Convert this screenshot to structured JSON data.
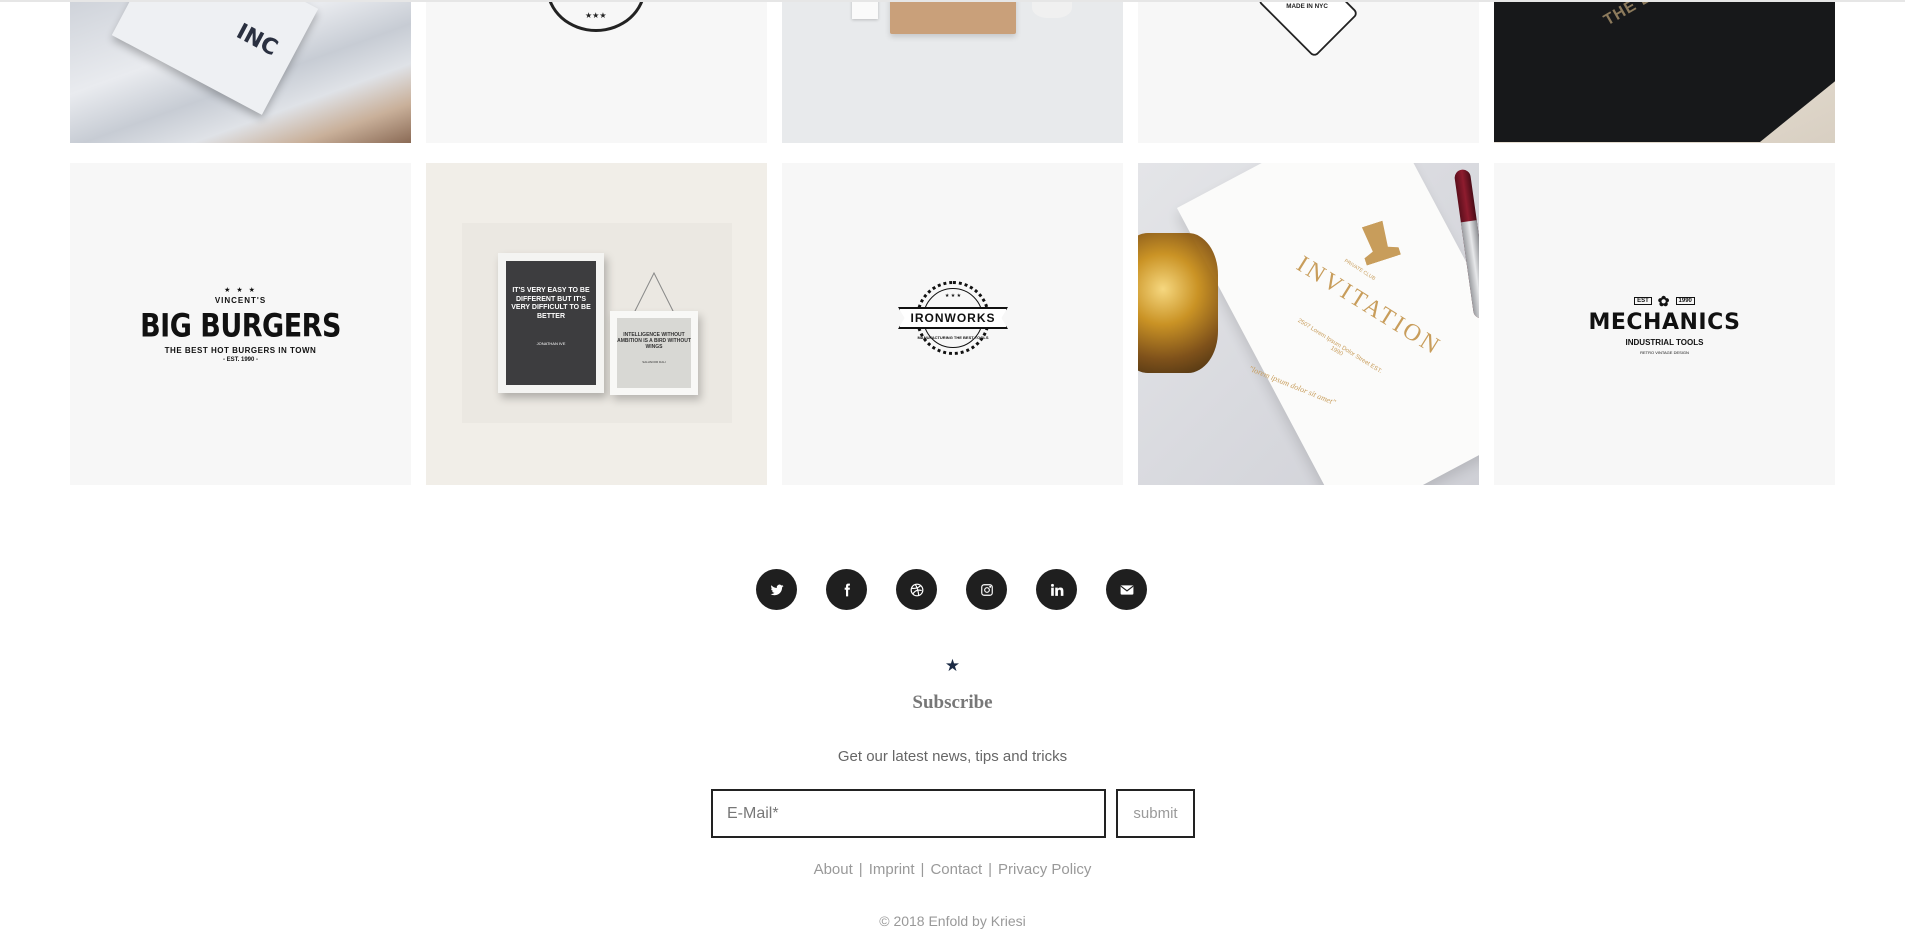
{
  "portfolio": {
    "row1": [
      {
        "name": "business-card-inc",
        "visible_text": "INC"
      },
      {
        "name": "round-badge-logo",
        "visible_text": "★★★"
      },
      {
        "name": "kraft-box-packaging",
        "visible_text": ""
      },
      {
        "name": "made-in-nyc-badge",
        "visible_text": "MADE IN NYC"
      },
      {
        "name": "black-tshirt",
        "visible_text": "THE B"
      }
    ],
    "big_burgers": {
      "stars": "★ ★ ★",
      "brand": "VINCENT'S",
      "title": "BIG BURGERS",
      "tagline": "THE BEST HOT BURGERS IN TOWN",
      "est": "- EST. 1990 -"
    },
    "quote_frames": {
      "dark_quote": "IT'S VERY EASY TO BE DIFFERENT BUT IT'S VERY DIFFICULT TO BE BETTER",
      "dark_author": "JONATHAN IVE",
      "light_quote": "INTELLIGENCE WITHOUT AMBITION IS A BIRD WITHOUT WINGS",
      "light_author": "SALVADOR DALI"
    },
    "ironworks": {
      "stars": "★ ★ ★",
      "est": "EST. 1990",
      "title": "IRONWORKS",
      "sub": "MANUFACTURING THE BEST TOOLS"
    },
    "invitation": {
      "club": "PRIVATE CLUB",
      "title": "INVITATION",
      "address": "2507 Lorem Ipsum Dolor Street",
      "est": "EST. 1990",
      "script": "\"lorem ipsum dolor sit amet\""
    },
    "mechanics": {
      "est_left": "EST",
      "est_right": "1990",
      "gear": "✿",
      "title": "MECHANICS",
      "sub": "INDUSTRIAL TOOLS",
      "tiny": "RETRO VINTAGE DESIGN"
    }
  },
  "social": [
    {
      "name": "twitter-icon",
      "glyph": "twitter"
    },
    {
      "name": "facebook-icon",
      "glyph": "f"
    },
    {
      "name": "dribbble-icon",
      "glyph": "dribbble"
    },
    {
      "name": "instagram-icon",
      "glyph": "instagram"
    },
    {
      "name": "linkedin-icon",
      "glyph": "in"
    },
    {
      "name": "mail-icon",
      "glyph": "mail"
    }
  ],
  "subscribe": {
    "star": "★",
    "title": "Subscribe",
    "subtitle": "Get our latest news, tips and tricks",
    "email_placeholder": "E-Mail*",
    "submit_label": "submit"
  },
  "footer": {
    "links": [
      "About",
      "Imprint",
      "Contact",
      "Privacy Policy"
    ],
    "separator": "|",
    "copyright": "© 2018 Enfold by Kriesi"
  },
  "colors": {
    "social_bg": "#1f1f1f",
    "star": "#1b2a44",
    "gold": "#c89d5b",
    "muted_text": "#999999"
  }
}
